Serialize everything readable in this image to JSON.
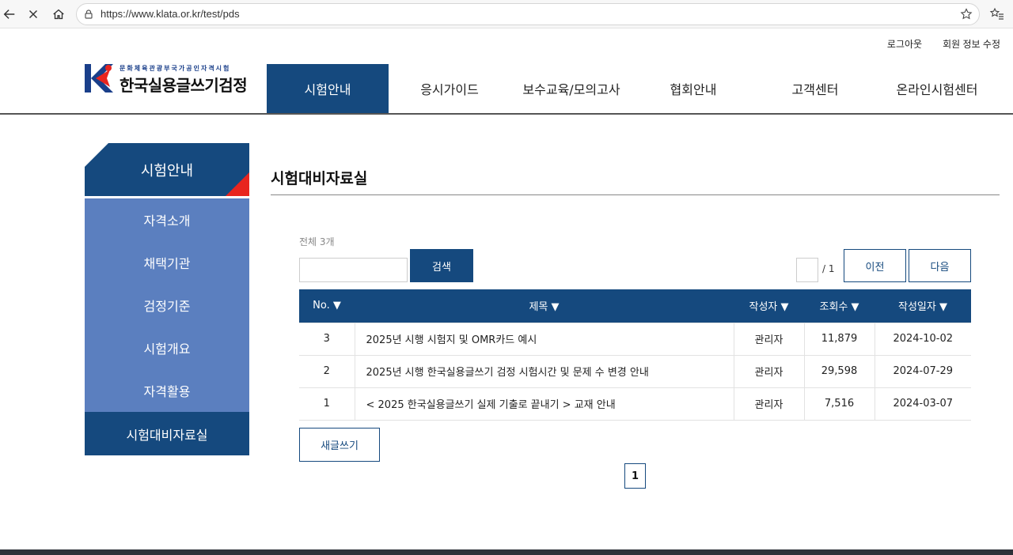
{
  "browser": {
    "url": "https://www.klata.or.kr/test/pds"
  },
  "header": {
    "top_links": [
      "로그아웃",
      "회원 정보 수정"
    ],
    "logo_sub": "문화체육관광부국가공인자격시험",
    "logo_main": "한국실용글쓰기검정",
    "nav": [
      "시험안내",
      "응시가이드",
      "보수교육/모의고사",
      "협회안내",
      "고객센터",
      "온라인시험센터"
    ],
    "active_nav": 0
  },
  "sidebar": {
    "title": "시험안내",
    "items": [
      "자격소개",
      "채택기관",
      "검정기준",
      "시험개요",
      "자격활용",
      "시험대비자료실"
    ],
    "active_item": 5
  },
  "content": {
    "title": "시험대비자료실",
    "total_label": "전체 3개",
    "search_button": "검색",
    "page_total": "/ 1",
    "prev_button": "이전",
    "next_button": "다음",
    "columns": [
      "No. ▼",
      "제목 ▼",
      "작성자 ▼",
      "조회수 ▼",
      "작성일자 ▼"
    ],
    "rows": [
      {
        "no": "3",
        "subject": "2025년 시행 시험지 및 OMR카드 예시",
        "author": "관리자",
        "views": "11,879",
        "date": "2024-10-02"
      },
      {
        "no": "2",
        "subject": "2025년 시행 한국실용글쓰기 검정 시험시간 및 문제 수 변경 안내",
        "author": "관리자",
        "views": "29,598",
        "date": "2024-07-29"
      },
      {
        "no": "1",
        "subject": "< 2025 한국실용글쓰기 실제 기출로 끝내기 > 교재 안내",
        "author": "관리자",
        "views": "7,516",
        "date": "2024-03-07"
      }
    ],
    "write_button": "새글쓰기",
    "current_page": "1"
  }
}
